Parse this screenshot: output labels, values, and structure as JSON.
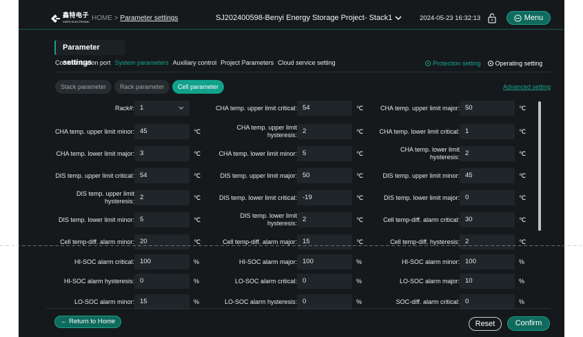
{
  "header": {
    "logo_text": "鑫特电子",
    "logo_sub": "XINTE ELECTRONIC",
    "breadcrumb_home": "HOME",
    "breadcrumb_sep": ">",
    "breadcrumb_current": "Parameter settings",
    "project_name": "SJ202400598-Benyi Energy Storage Project- Stack1",
    "datetime": "2024-05-23 16:32:13",
    "menu_label": "Menu"
  },
  "panel": {
    "title": "Parameter settings",
    "tabs": [
      {
        "label": "Communication port",
        "active": false
      },
      {
        "label": "System parameters",
        "active": true
      },
      {
        "label": "Auxiliary control",
        "active": false
      },
      {
        "label": "Project Parameters",
        "active": false
      },
      {
        "label": "Cloud service setting",
        "active": false
      }
    ],
    "radios": [
      {
        "label": "Protection setting",
        "selected": true
      },
      {
        "label": "Operating setting",
        "selected": false
      }
    ],
    "subtabs": [
      {
        "label": "Stack parameter",
        "active": false
      },
      {
        "label": "Rack parameter",
        "active": false
      },
      {
        "label": "Cell parameter",
        "active": true
      }
    ],
    "advanced_label": "Advanced setting"
  },
  "fields": [
    [
      {
        "label": "Rack#:",
        "value": "1",
        "unit": ""
      },
      {
        "label": "CHA temp. upper limit critical:",
        "value": "54",
        "unit": "℃"
      },
      {
        "label": "CHA temp. upper limit major:",
        "value": "50",
        "unit": "℃"
      }
    ],
    [
      {
        "label": "CHA temp. upper limit minor:",
        "value": "45",
        "unit": "℃"
      },
      {
        "label": "CHA temp. upper limit hysteresis:",
        "value": "2",
        "unit": "℃"
      },
      {
        "label": "CHA temp. lower limit critical:",
        "value": "1",
        "unit": "℃"
      }
    ],
    [
      {
        "label": "CHA temp. lower limit major:",
        "value": "3",
        "unit": "℃"
      },
      {
        "label": "CHA temp. lower limit minor:",
        "value": "5",
        "unit": "℃"
      },
      {
        "label": "CHA temp. lower limit hysteresis:",
        "value": "2",
        "unit": "℃"
      }
    ],
    [
      {
        "label": "DIS temp. upper limit critical:",
        "value": "54",
        "unit": "℃"
      },
      {
        "label": "DIS temp. upper limit major:",
        "value": "50",
        "unit": "℃"
      },
      {
        "label": "DIS temp. upper limit minor:",
        "value": "45",
        "unit": "℃"
      }
    ],
    [
      {
        "label": "DIS temp. upper limit hysteresis:",
        "value": "2",
        "unit": "℃"
      },
      {
        "label": "DIS temp. lower limit critical:",
        "value": "-19",
        "unit": "℃"
      },
      {
        "label": "DIS temp. lower limit major:",
        "value": "0",
        "unit": "℃"
      }
    ],
    [
      {
        "label": "DIS temp. lower limit minor:",
        "value": "5",
        "unit": "℃"
      },
      {
        "label": "DIS temp. lower limit hysteresis:",
        "value": "2",
        "unit": "℃"
      },
      {
        "label": "Cell temp-diff. alarm critical:",
        "value": "30",
        "unit": "℃"
      }
    ],
    [
      {
        "label": "Cell temp-diff. alarm minor:",
        "value": "20",
        "unit": "℃"
      },
      {
        "label": "Cell temp-diff. alarm major:",
        "value": "15",
        "unit": "℃"
      },
      {
        "label": "Cell temp-diff. hysteresis:",
        "value": "2",
        "unit": "℃"
      }
    ],
    [
      {
        "label": "HI-SOC alarm critical:",
        "value": "100",
        "unit": "%"
      },
      {
        "label": "HI-SOC alarm major:",
        "value": "100",
        "unit": "%"
      },
      {
        "label": "HI-SOC alarm minor:",
        "value": "100",
        "unit": "%"
      }
    ],
    [
      {
        "label": "HI-SOC alarm hysteresis:",
        "value": "0",
        "unit": "%"
      },
      {
        "label": "LO-SOC alarm critical:",
        "value": "0",
        "unit": "%"
      },
      {
        "label": "LO-SOC alarm major:",
        "value": "10",
        "unit": "%"
      }
    ],
    [
      {
        "label": "LO-SOC alarm minor:",
        "value": "15",
        "unit": "%"
      },
      {
        "label": "LO-SOC alarm hysteresis:",
        "value": "0",
        "unit": "%"
      },
      {
        "label": "SOC-diff. alarm critical:",
        "value": "0",
        "unit": "%"
      }
    ]
  ],
  "footer": {
    "return_label": "← Return to Home",
    "reset_label": "Reset",
    "confirm_label": "Confirm"
  },
  "colors": {
    "background": "#15191c",
    "accent": "#12a18b",
    "input_bg": "#1f2528"
  }
}
